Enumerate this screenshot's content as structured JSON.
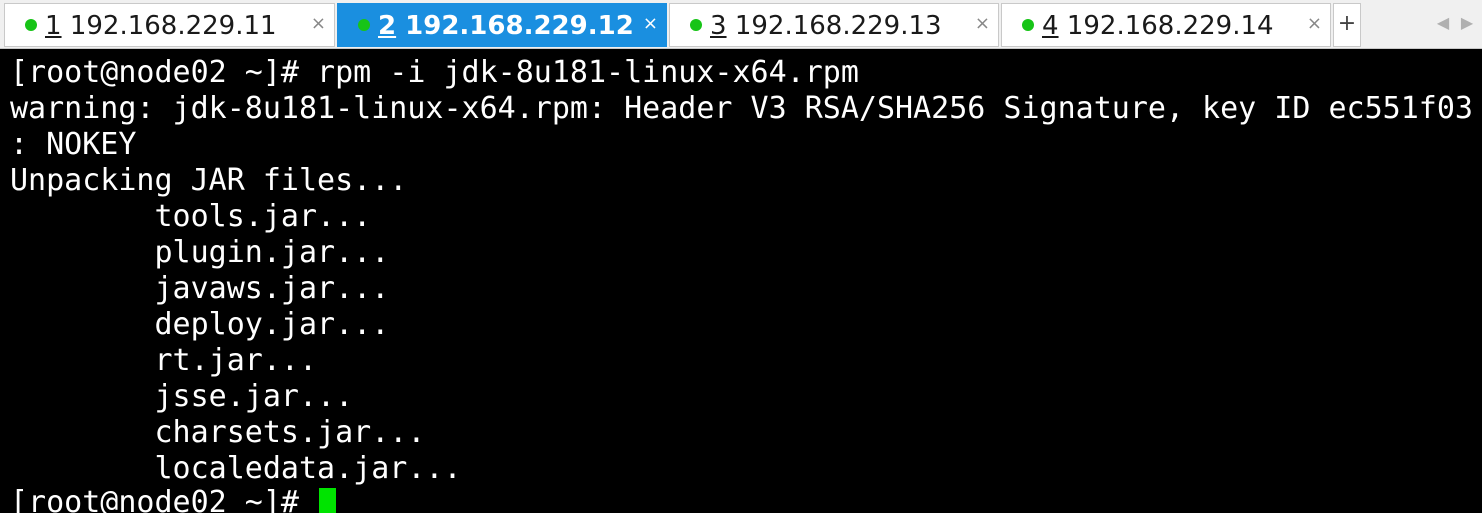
{
  "tabs": [
    {
      "num": "1",
      "host": "192.168.229.11",
      "status_color": "#17c417",
      "active": false,
      "close": "×"
    },
    {
      "num": "2",
      "host": "192.168.229.12",
      "status_color": "#17c417",
      "active": true,
      "close": "×"
    },
    {
      "num": "3",
      "host": "192.168.229.13",
      "status_color": "#17c417",
      "active": false,
      "close": "×"
    },
    {
      "num": "4",
      "host": "192.168.229.14",
      "status_color": "#17c417",
      "active": false,
      "close": "×"
    }
  ],
  "tabbar": {
    "add_label": "+",
    "prev_arrow": "◀",
    "next_arrow": "▶"
  },
  "terminal": {
    "lines": [
      "[root@node02 ~]# rpm -i jdk-8u181-linux-x64.rpm",
      "warning: jdk-8u181-linux-x64.rpm: Header V3 RSA/SHA256 Signature, key ID ec551f03",
      ": NOKEY",
      "Unpacking JAR files...",
      "        tools.jar...",
      "        plugin.jar...",
      "        javaws.jar...",
      "        deploy.jar...",
      "        rt.jar...",
      "        jsse.jar...",
      "        charsets.jar...",
      "        localedata.jar...",
      "[root@node02 ~]# "
    ],
    "cursor_color": "#00e400",
    "background": "#000000",
    "foreground": "#ffffff"
  }
}
